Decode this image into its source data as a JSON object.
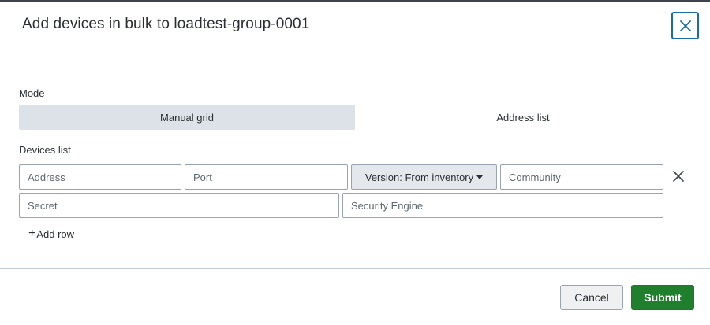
{
  "dialog": {
    "title": "Add devices in bulk to loadtest-group-0001"
  },
  "mode": {
    "label": "Mode",
    "options": [
      {
        "label": "Manual grid",
        "selected": true
      },
      {
        "label": "Address list",
        "selected": false
      }
    ]
  },
  "devices": {
    "label": "Devices list",
    "row": {
      "address_placeholder": "Address",
      "port_placeholder": "Port",
      "version_label": "Version: From inventory",
      "community_placeholder": "Community",
      "secret_placeholder": "Secret",
      "security_engine_placeholder": "Security Engine"
    },
    "add_row_label": "Add row"
  },
  "footer": {
    "cancel_label": "Cancel",
    "submit_label": "Submit"
  },
  "colors": {
    "accent": "#1a6ba8",
    "submit": "#1f7f2d",
    "segment_selected": "#dde2e8"
  },
  "icons": {
    "close": "close-icon",
    "remove_row": "remove-row-icon",
    "add": "plus-icon",
    "dropdown": "caret-down-icon"
  }
}
